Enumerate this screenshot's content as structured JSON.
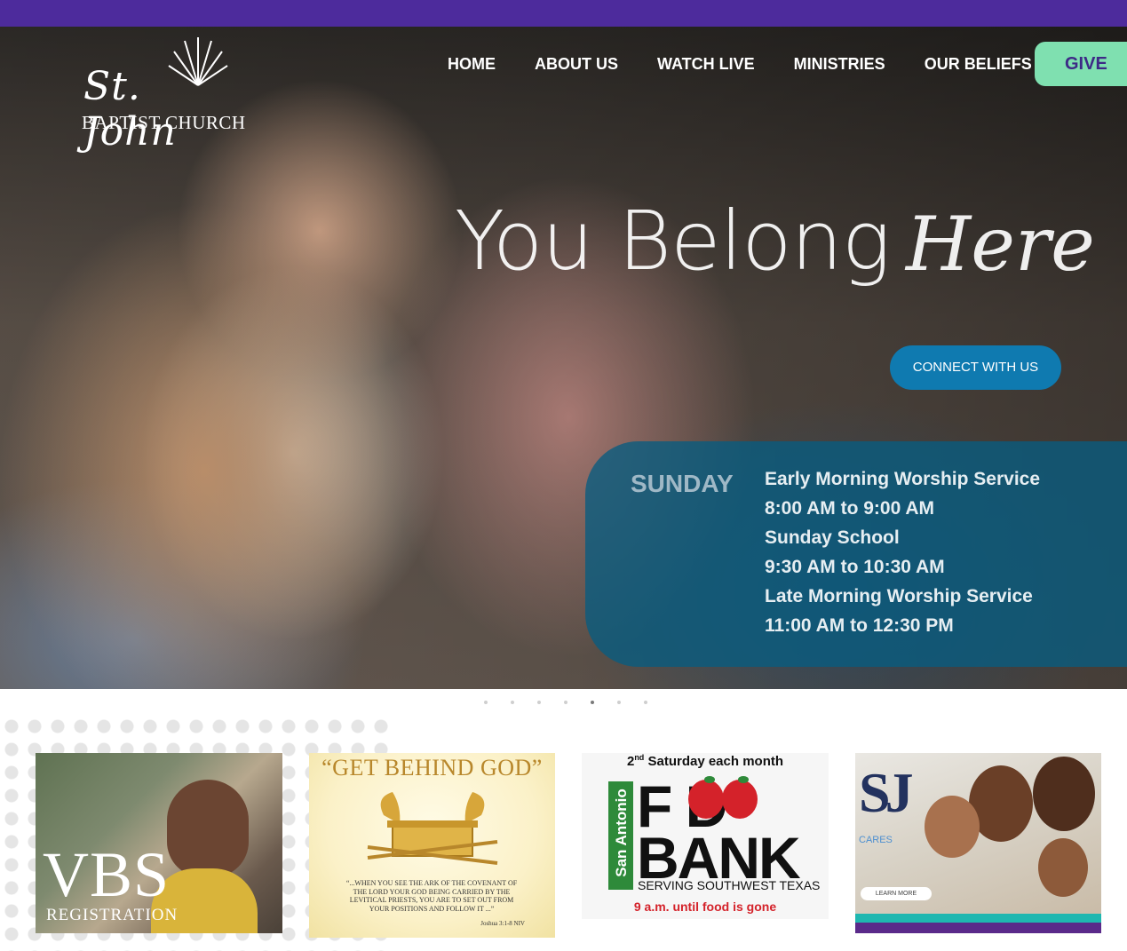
{
  "logo": {
    "name": "St. John",
    "subtitle": "BAPTIST CHURCH"
  },
  "nav": {
    "items": [
      "HOME",
      "ABOUT US",
      "WATCH LIVE",
      "MINISTRIES",
      "OUR BELIEFS"
    ],
    "give_label": "GIVE"
  },
  "hero": {
    "headline": "You Belong",
    "headline_script": "Here",
    "connect_label": "CONNECT WITH US",
    "slider_dot_count": 7,
    "active_slide": 5
  },
  "schedule": {
    "day": "SUNDAY",
    "lines": [
      "Early Morning Worship Service",
      "8:00 AM to 9:00 AM",
      "Sunday School",
      "9:30 AM to 10:30 AM",
      "Late Morning Worship Service",
      "11:00 AM to 12:30 PM"
    ]
  },
  "cards": {
    "vbs": {
      "title": "VBS",
      "subtitle": "REGISTRATION"
    },
    "get_behind_god": {
      "title": "“GET BEHIND GOD”",
      "verse": "“...WHEN YOU SEE THE ARK OF THE COVENANT OF THE LORD YOUR GOD BEING CARRIED BY THE LEVITICAL PRIESTS, YOU ARE TO SET OUT FROM YOUR POSITIONS AND FOLLOW IT ...”",
      "reference": "Joshua 3:1-8 NIV"
    },
    "food_bank": {
      "top": "2",
      "top_sup": "nd",
      "top_rest": " Saturday each month",
      "side": "San Antonio",
      "food": "F  D",
      "bank": "BANK",
      "serving": "SERVING SOUTHWEST TEXAS",
      "bottom": "9 a.m. until food is gone"
    },
    "sj_cares": {
      "logo": "SJ",
      "cares": "CARES",
      "learn_more": "LEARN MORE"
    }
  },
  "colors": {
    "topbar": "#4d2b9c",
    "give": "#7fe0b0",
    "connect": "#0f7ab0",
    "schedule_panel": "#085c80"
  }
}
